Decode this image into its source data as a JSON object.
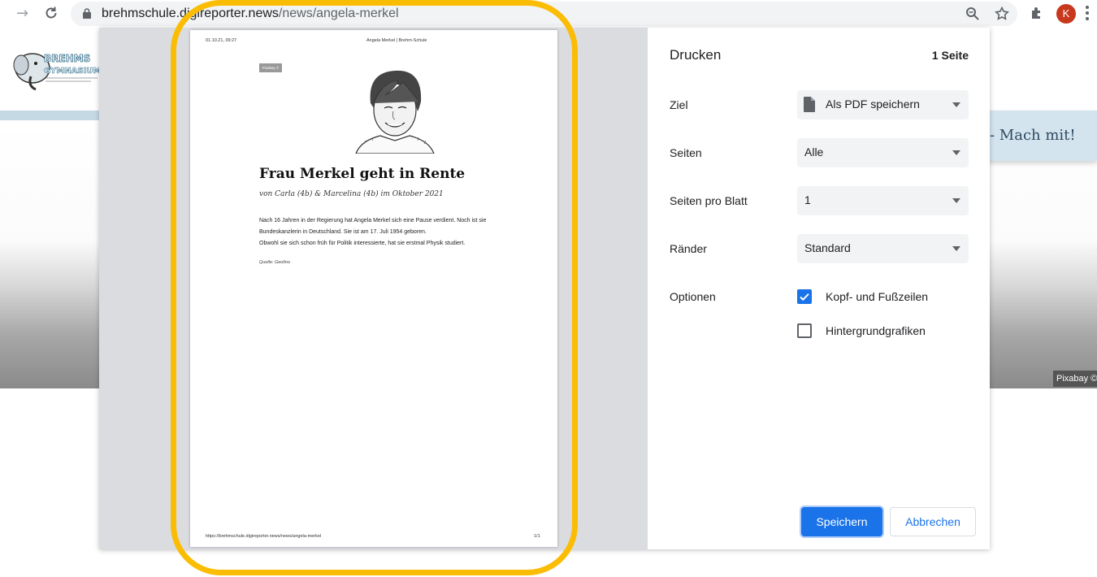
{
  "browser": {
    "url_host": "brehmschule.digireporter.news",
    "url_path": "/news/angela-merkel",
    "profile_initial": "K"
  },
  "site": {
    "banner_text": "- Mach mit!",
    "image_credit": "Pixabay ©"
  },
  "preview": {
    "header_datetime": "01.10.21, 09:27",
    "header_title": "Angela Merkel | Brehm-Schule",
    "image_credit": "Pixabay ©",
    "article_title": "Frau Merkel geht in Rente",
    "byline": "von Carla (4b) & Marcelina (4b) im Oktober 2021",
    "body_line1": "Nach 16 Jahren in der Regierung hat Angela Merkel sich eine Pause verdient. Noch ist sie",
    "body_line2": "Bundeskanzlerin in Deutschland. Sie ist am 17. Juli 1954 geboren.",
    "body_line3": "Obwohl sie sich schon früh für Politik interessierte, hat sie erstmal Physik studiert.",
    "source": "Quelle: Geolino",
    "footer_url": "https://brehmschule.digireporter.news/news/angela-merkel",
    "footer_page": "1/1"
  },
  "print": {
    "title": "Drucken",
    "page_count": "1 Seite",
    "destination_label": "Ziel",
    "destination_value": "Als PDF speichern",
    "pages_label": "Seiten",
    "pages_value": "Alle",
    "pages_per_sheet_label": "Seiten pro Blatt",
    "pages_per_sheet_value": "1",
    "margins_label": "Ränder",
    "margins_value": "Standard",
    "options_label": "Optionen",
    "option_headers_footers": "Kopf- und Fußzeilen",
    "option_headers_footers_checked": true,
    "option_background_graphics": "Hintergrundgrafiken",
    "option_background_graphics_checked": false,
    "save_button": "Speichern",
    "cancel_button": "Abbrechen"
  },
  "colors": {
    "accent": "#1a73e8",
    "highlight": "#fbbc04",
    "avatar": "#c8381c"
  },
  "icons": [
    "back-arrow-icon",
    "forward-arrow-icon",
    "reload-icon",
    "lock-icon",
    "zoom-icon",
    "star-icon",
    "extensions-icon",
    "more-menu-icon",
    "file-icon",
    "caret-down-icon",
    "check-icon"
  ]
}
